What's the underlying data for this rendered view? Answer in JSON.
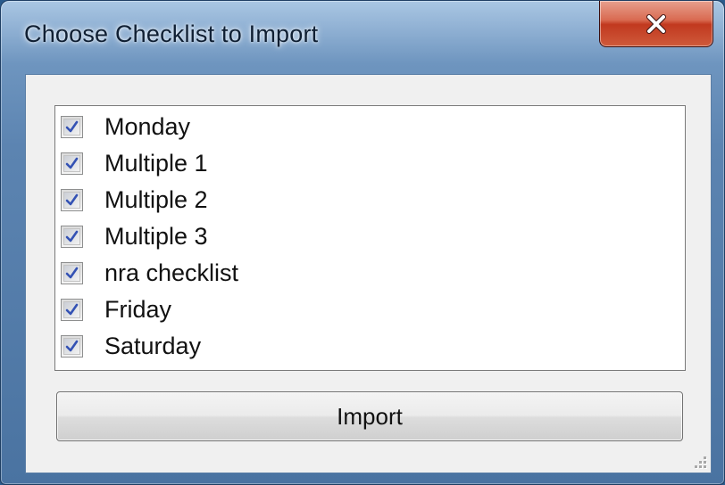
{
  "window": {
    "title": "Choose Checklist to Import"
  },
  "titlebar": {
    "close_icon": "close-x-icon"
  },
  "checklist": {
    "items": [
      {
        "label": "Monday",
        "checked": true
      },
      {
        "label": "Multiple 1",
        "checked": true
      },
      {
        "label": "Multiple 2",
        "checked": true
      },
      {
        "label": "Multiple 3",
        "checked": true
      },
      {
        "label": "nra checklist",
        "checked": true
      },
      {
        "label": "Friday",
        "checked": true
      },
      {
        "label": "Saturday",
        "checked": true
      }
    ]
  },
  "actions": {
    "import_label": "Import"
  },
  "colors": {
    "check_mark": "#3452b4",
    "close_button": "#c1391f",
    "frame": "#4a73a1"
  }
}
